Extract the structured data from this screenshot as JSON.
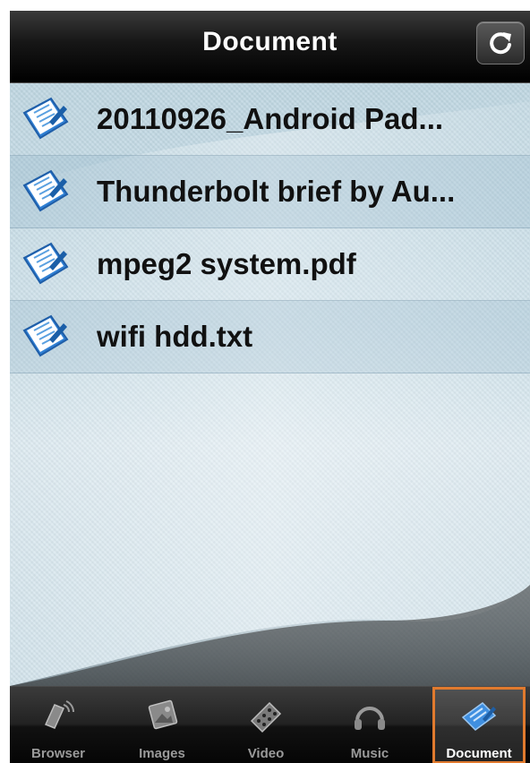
{
  "navbar": {
    "title": "Document",
    "refresh_icon": "refresh-icon"
  },
  "documents": [
    {
      "name": "20110926_Android Pad...",
      "icon": "document-icon"
    },
    {
      "name": "Thunderbolt brief by Au...",
      "icon": "document-icon"
    },
    {
      "name": "mpeg2 system.pdf",
      "icon": "document-icon"
    },
    {
      "name": "wifi hdd.txt",
      "icon": "document-icon"
    }
  ],
  "tabbar": {
    "tabs": [
      {
        "label": "Browser",
        "icon": "browser-icon",
        "selected": false
      },
      {
        "label": "Images",
        "icon": "images-icon",
        "selected": false
      },
      {
        "label": "Video",
        "icon": "video-icon",
        "selected": false
      },
      {
        "label": "Music",
        "icon": "music-icon",
        "selected": false
      },
      {
        "label": "Document",
        "icon": "document-icon",
        "selected": true
      }
    ]
  },
  "colors": {
    "accent": "#e07a2e",
    "content_bg": "#c7dde7",
    "bar_bg": "#111111"
  }
}
